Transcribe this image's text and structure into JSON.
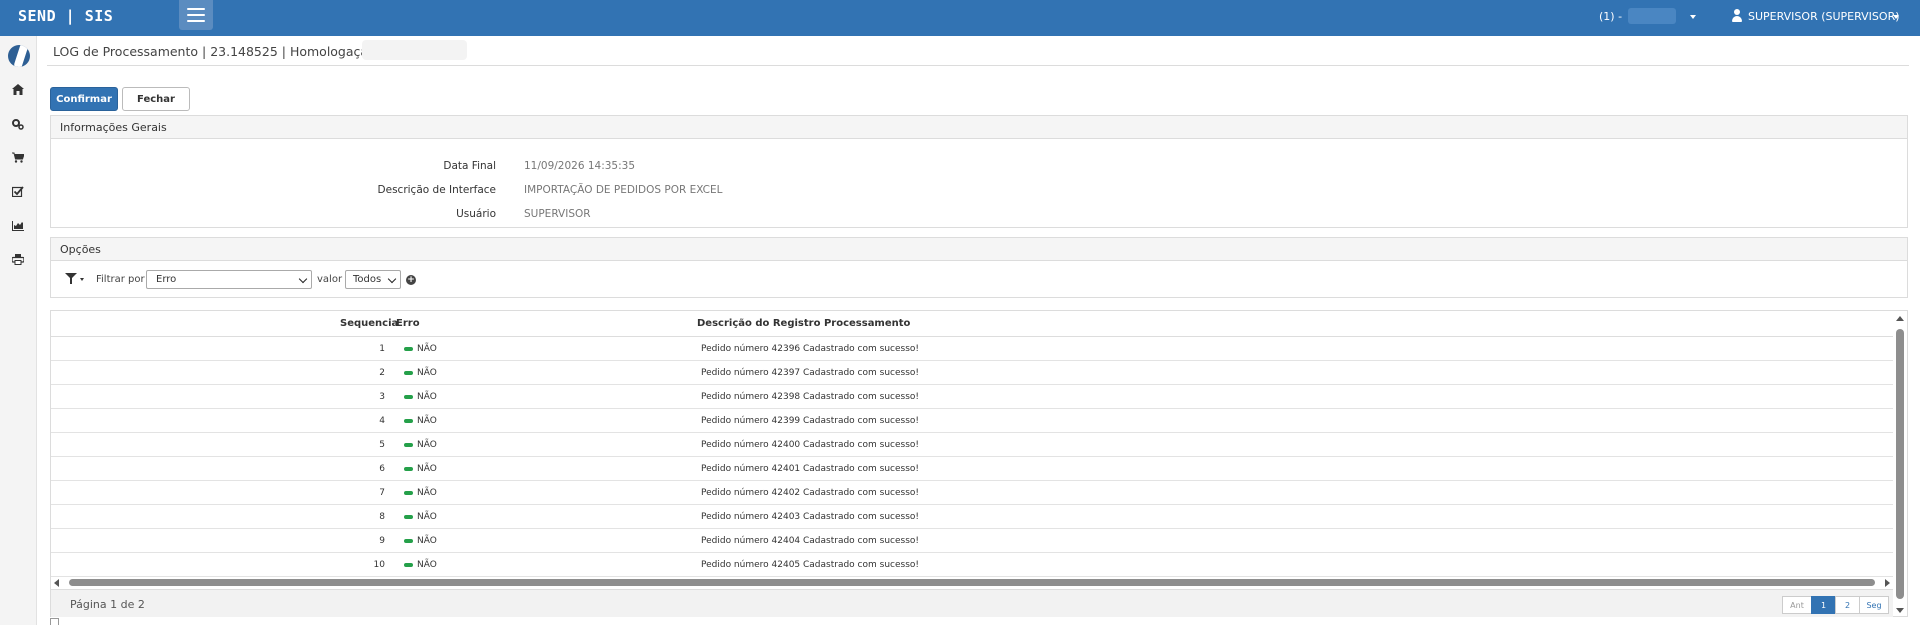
{
  "header": {
    "brand": "SEND | SIS",
    "company_prefix": "(1) -",
    "user": "SUPERVISOR (SUPERVISOR)",
    "colors": {
      "bar": "#3273b3",
      "accent": "#25a04a"
    }
  },
  "sidebar": {
    "items": [
      {
        "icon": "home-icon"
      },
      {
        "icon": "gears-icon"
      },
      {
        "icon": "shopping-cart-icon"
      },
      {
        "icon": "checkbox-icon"
      },
      {
        "icon": "chart-icon"
      },
      {
        "icon": "print-icon"
      }
    ]
  },
  "page": {
    "title": "LOG de Processamento | 23.148525 | Homologação |"
  },
  "toolbar": {
    "confirm_label": "Confirmar",
    "close_label": "Fechar"
  },
  "info_panel": {
    "title": "Informações Gerais",
    "fields": [
      {
        "label": "Data Final",
        "value": "11/09/2026 14:35:35"
      },
      {
        "label": "Descrição de Interface",
        "value": "IMPORTAÇÃO DE PEDIDOS POR EXCEL"
      },
      {
        "label": "Usuário",
        "value": "SUPERVISOR"
      }
    ]
  },
  "options_panel": {
    "title": "Opções",
    "filter_label": "Filtrar por",
    "filter_value": "Erro",
    "value_label": "valor",
    "value_selected": "Todos"
  },
  "grid": {
    "columns": [
      "Sequencia",
      "Erro",
      "Descrição do Registro Processamento"
    ],
    "rows": [
      {
        "seq": "1",
        "erro": "NÃO",
        "desc": "Pedido número 42396 Cadastrado com sucesso!"
      },
      {
        "seq": "2",
        "erro": "NÃO",
        "desc": "Pedido número 42397 Cadastrado com sucesso!"
      },
      {
        "seq": "3",
        "erro": "NÃO",
        "desc": "Pedido número 42398 Cadastrado com sucesso!"
      },
      {
        "seq": "4",
        "erro": "NÃO",
        "desc": "Pedido número 42399 Cadastrado com sucesso!"
      },
      {
        "seq": "5",
        "erro": "NÃO",
        "desc": "Pedido número 42400 Cadastrado com sucesso!"
      },
      {
        "seq": "6",
        "erro": "NÃO",
        "desc": "Pedido número 42401 Cadastrado com sucesso!"
      },
      {
        "seq": "7",
        "erro": "NÃO",
        "desc": "Pedido número 42402 Cadastrado com sucesso!"
      },
      {
        "seq": "8",
        "erro": "NÃO",
        "desc": "Pedido número 42403 Cadastrado com sucesso!"
      },
      {
        "seq": "9",
        "erro": "NÃO",
        "desc": "Pedido número 42404 Cadastrado com sucesso!"
      },
      {
        "seq": "10",
        "erro": "NÃO",
        "desc": "Pedido número 42405 Cadastrado com sucesso!"
      }
    ],
    "page_info": "Página 1 de 2",
    "pager": [
      "Ant",
      "1",
      "2",
      "Seg"
    ]
  }
}
